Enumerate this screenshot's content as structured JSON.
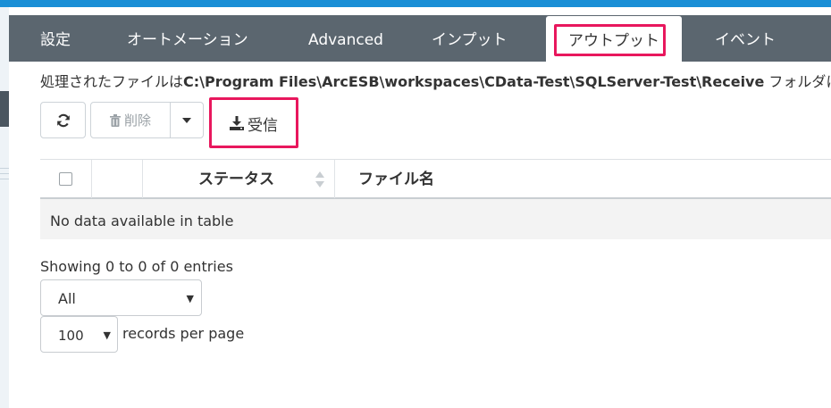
{
  "tabs": [
    {
      "label": "設定"
    },
    {
      "label": "オートメーション"
    },
    {
      "label": "Advanced"
    },
    {
      "label": "インプット"
    },
    {
      "label": "アウトプット"
    },
    {
      "label": "イベント"
    }
  ],
  "description": {
    "prefix": "処理されたファイルは",
    "path": "C:\\Program Files\\ArcESB\\workspaces\\CData-Test\\SQLServer-Test\\Receive",
    "suffix": " フォルダに"
  },
  "toolbar": {
    "delete_label": "削除",
    "receive_label": "受信"
  },
  "table": {
    "columns": [
      "ステータス",
      "ファイル名"
    ],
    "empty_message": "No data available in table"
  },
  "footer": {
    "info": "Showing 0 to 0 of 0 entries",
    "filter_selected": "All",
    "page_size_selected": "100",
    "records_per_page": "records per page"
  },
  "colors": {
    "tab_bar": "#5b666f",
    "highlight": "#e8175d",
    "top_strip": "#1a8fd6"
  },
  "icons": [
    "refresh-icon",
    "trash-icon",
    "caret-down-icon",
    "download-icon",
    "sort-icon"
  ]
}
